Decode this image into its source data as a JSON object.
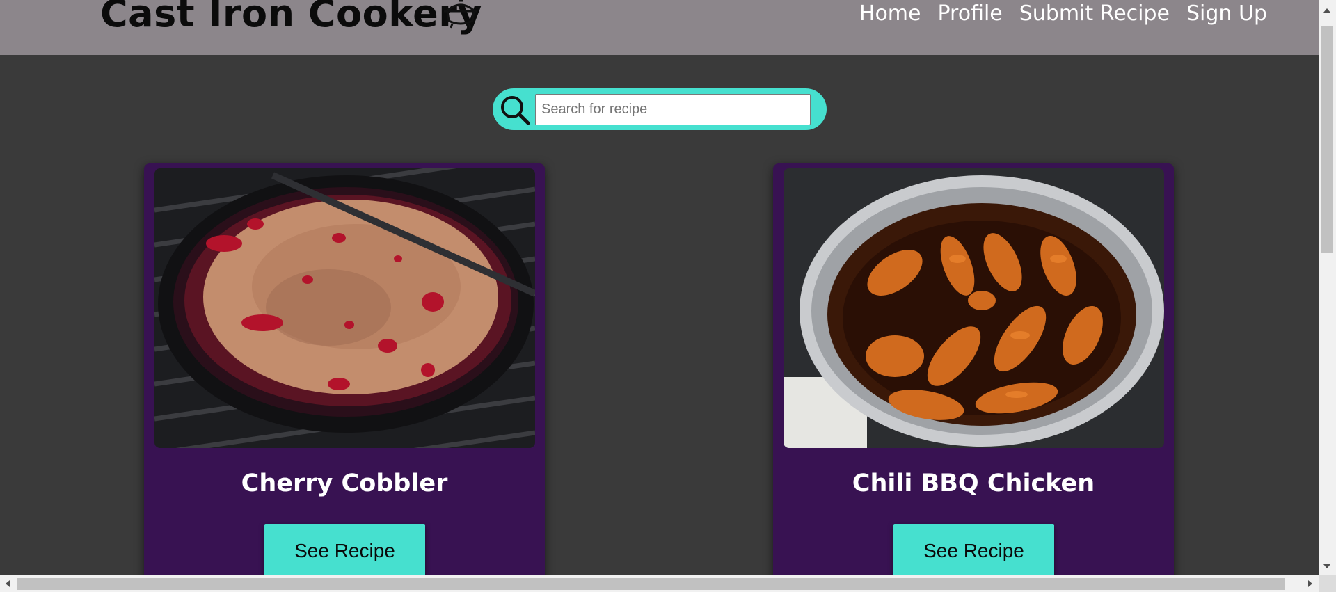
{
  "header": {
    "brand_title": "Cast Iron Cookery",
    "brand_icon": "dutch-oven-icon",
    "nav": [
      {
        "label": "Home"
      },
      {
        "label": "Profile"
      },
      {
        "label": "Submit Recipe"
      },
      {
        "label": "Sign Up"
      }
    ]
  },
  "search": {
    "icon": "search-icon",
    "placeholder": "Search for recipe",
    "value": ""
  },
  "recipes": [
    {
      "title": "Cherry Cobbler",
      "button_label": "See Recipe",
      "image": "cherry-cobbler-photo"
    },
    {
      "title": "Chili BBQ Chicken",
      "button_label": "See Recipe",
      "image": "chili-bbq-chicken-photo"
    }
  ],
  "colors": {
    "header_bg": "#8c868b",
    "page_bg": "#3a3a3a",
    "accent": "#46e0cf",
    "card_bg": "#381252"
  }
}
